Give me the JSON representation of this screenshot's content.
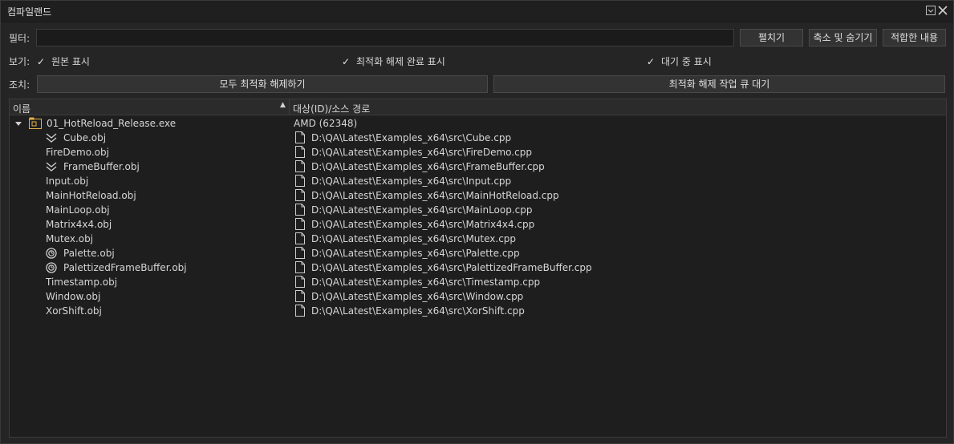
{
  "window": {
    "title": "컴파일랜드"
  },
  "filter": {
    "label": "필터:",
    "value": "",
    "expand_label": "펼치기",
    "collapse_label": "축소 및 숨기기",
    "fit_label": "적합한 내용"
  },
  "view": {
    "label": "보기:",
    "show_original": "원본 표시",
    "show_deopt_done": "최적화 해제 완료 표시",
    "show_pending": "대기 중 표시"
  },
  "actions": {
    "label": "조치:",
    "deopt_all": "모두 최적화 해제하기",
    "queue_deopt": "최적화 해제 작업 큐 대기"
  },
  "tree": {
    "header_name": "이름",
    "header_target": "대상(ID)/소스 경로",
    "root": {
      "name": "01_HotReload_Release.exe",
      "target": "AMD (62348)"
    },
    "items": [
      {
        "name": "Cube.obj",
        "path": "D:\\QA\\Latest\\Examples_x64\\src\\Cube.cpp",
        "icon": "deoptimized-chevron-icon"
      },
      {
        "name": "FireDemo.obj",
        "path": "D:\\QA\\Latest\\Examples_x64\\src\\FireDemo.cpp",
        "icon": ""
      },
      {
        "name": "FrameBuffer.obj",
        "path": "D:\\QA\\Latest\\Examples_x64\\src\\FrameBuffer.cpp",
        "icon": "deoptimized-chevron-icon"
      },
      {
        "name": "Input.obj",
        "path": "D:\\QA\\Latest\\Examples_x64\\src\\Input.cpp",
        "icon": ""
      },
      {
        "name": "MainHotReload.obj",
        "path": "D:\\QA\\Latest\\Examples_x64\\src\\MainHotReload.cpp",
        "icon": ""
      },
      {
        "name": "MainLoop.obj",
        "path": "D:\\QA\\Latest\\Examples_x64\\src\\MainLoop.cpp",
        "icon": ""
      },
      {
        "name": "Matrix4x4.obj",
        "path": "D:\\QA\\Latest\\Examples_x64\\src\\Matrix4x4.cpp",
        "icon": ""
      },
      {
        "name": "Mutex.obj",
        "path": "D:\\QA\\Latest\\Examples_x64\\src\\Mutex.cpp",
        "icon": ""
      },
      {
        "name": "Palette.obj",
        "path": "D:\\QA\\Latest\\Examples_x64\\src\\Palette.cpp",
        "icon": "pending-clock-icon"
      },
      {
        "name": "PalettizedFrameBuffer.obj",
        "path": "D:\\QA\\Latest\\Examples_x64\\src\\PalettizedFrameBuffer.cpp",
        "icon": "pending-clock-icon"
      },
      {
        "name": "Timestamp.obj",
        "path": "D:\\QA\\Latest\\Examples_x64\\src\\Timestamp.cpp",
        "icon": ""
      },
      {
        "name": "Window.obj",
        "path": "D:\\QA\\Latest\\Examples_x64\\src\\Window.cpp",
        "icon": ""
      },
      {
        "name": "XorShift.obj",
        "path": "D:\\QA\\Latest\\Examples_x64\\src\\XorShift.cpp",
        "icon": ""
      }
    ]
  }
}
